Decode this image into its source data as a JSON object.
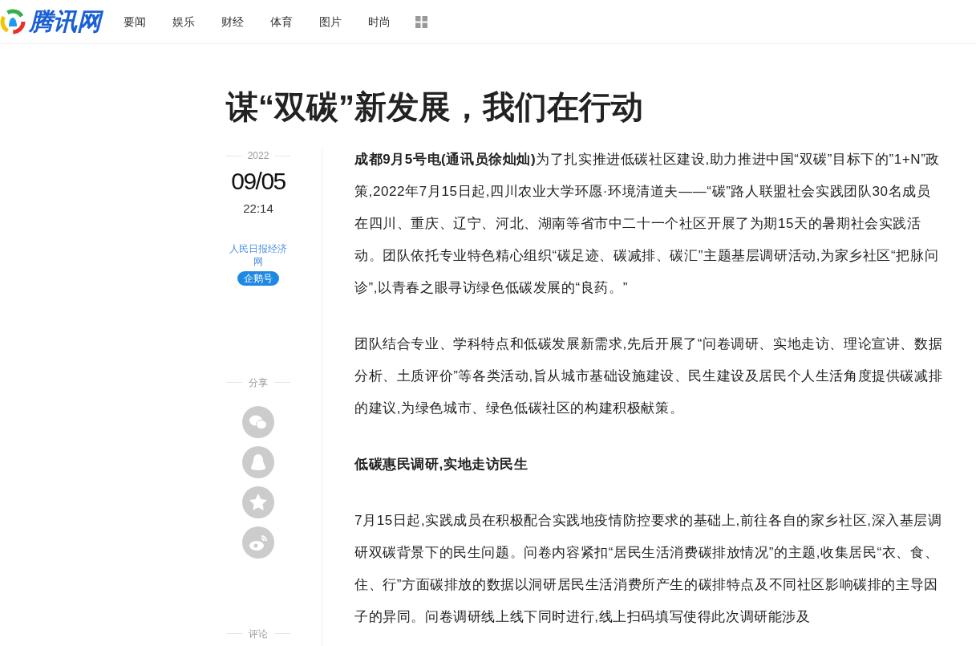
{
  "header": {
    "logo": "腾讯网",
    "nav": [
      "要闻",
      "娱乐",
      "财经",
      "体育",
      "图片",
      "时尚"
    ]
  },
  "article": {
    "title": "谋“双碳”新发展，我们在行动",
    "meta": {
      "year": "2022",
      "date": "09/05",
      "time": "22:14",
      "source": "人民日报经济网",
      "badge": "企鹅号"
    },
    "share": {
      "label": "分享"
    },
    "comment": {
      "label": "评论"
    },
    "body": [
      {
        "kind": "paragraph",
        "text": "**成都9月5号电(通讯员徐灿灿)**为了扎实推进低碳社区建设,助力推进中国“双碳”目标下的”1+N”政策,2022年7月15日起,四川农业大学环愿·环境清道夫——“碳”路人联盟社会实践团队30名成员在四川、重庆、辽宁、河北、湖南等省市中二十一个社区开展了为期15天的暑期社会实践活动。团队依托专业特色精心组织“碳足迹、碳减排、碳汇”主题基层调研活动,为家乡社区“把脉问诊”,以青春之眼寻访绿色低碳发展的“良药。”"
      },
      {
        "kind": "paragraph",
        "text": "团队结合专业、学科特点和低碳发展新需求,先后开展了“问卷调研、实地走访、理论宣讲、数据分析、土质评价”等各类活动,旨从城市基础设施建设、民生建设及居民个人生活角度提供碳减排的建议,为绿色城市、绿色低碳社区的构建积极献策。"
      },
      {
        "kind": "heading",
        "text": "低碳惠民调研,实地走访民生"
      },
      {
        "kind": "paragraph",
        "text": "7月15日起,实践成员在积极配合实践地疫情防控要求的基础上,前往各自的家乡社区,深入基层调研双碳背景下的民生问题。问卷内容紧扣“居民生活消费碳排放情况”的主题,收集居民“衣、食、住、行”方面碳排放的数据以洞研居民生活消费所产生的碳排特点及不同社区影响碳排的主导因子的异同。问卷调研线上线下同时进行,线上扫码填写使得此次调研能涉及"
      }
    ]
  }
}
